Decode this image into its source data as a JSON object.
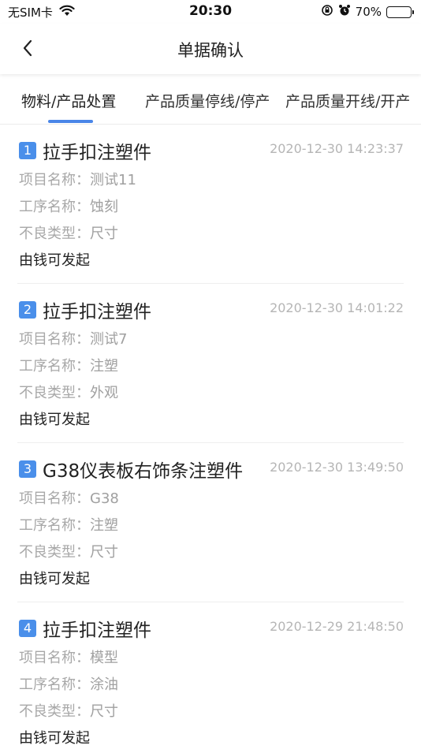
{
  "status_bar": {
    "carrier": "无SIM卡",
    "time": "20:30",
    "battery_percent": "70%",
    "battery_level": 0.7
  },
  "nav": {
    "title": "单据确认"
  },
  "tabs": [
    {
      "label": "物料/产品处置",
      "active": true
    },
    {
      "label": "产品质量停线/停产",
      "active": false
    },
    {
      "label": "产品质量开线/开产",
      "active": false
    }
  ],
  "field_labels": {
    "project": "项目名称：",
    "process": "工序名称：",
    "defect": "不良类型："
  },
  "items": [
    {
      "index": "1",
      "title": "拉手扣注塑件",
      "time": "2020-12-30 14:23:37",
      "project": "测试11",
      "process": "蚀刻",
      "defect": "尺寸",
      "initiator": "由钱可发起"
    },
    {
      "index": "2",
      "title": "拉手扣注塑件",
      "time": "2020-12-30 14:01:22",
      "project": "测试7",
      "process": "注塑",
      "defect": "外观",
      "initiator": "由钱可发起"
    },
    {
      "index": "3",
      "title": "G38仪表板右饰条注塑件",
      "time": "2020-12-30 13:49:50",
      "project": "G38",
      "process": "注塑",
      "defect": "尺寸",
      "initiator": "由钱可发起"
    },
    {
      "index": "4",
      "title": "拉手扣注塑件",
      "time": "2020-12-29 21:48:50",
      "project": "模型",
      "process": "涂油",
      "defect": "尺寸",
      "initiator": "由钱可发起"
    }
  ],
  "colors": {
    "accent": "#4a86e8",
    "index_badge": "#4a8fea",
    "muted_text": "#a8a8a8"
  }
}
